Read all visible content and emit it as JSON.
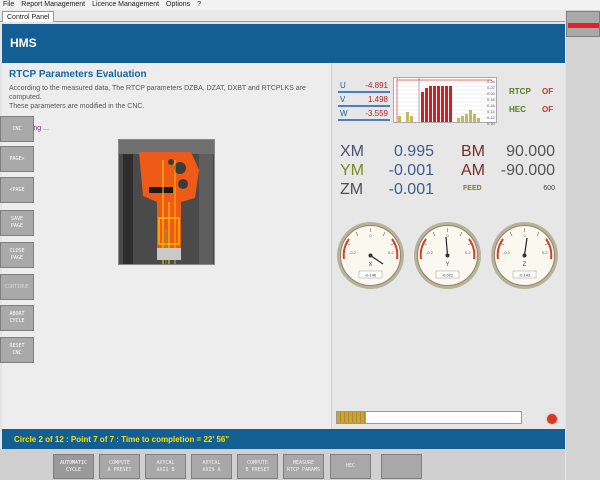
{
  "menu": [
    "File",
    "Report Management",
    "Licence Management",
    "Options",
    "?"
  ],
  "tab": "Control Panel",
  "header": {
    "title": "HMS"
  },
  "left": {
    "title": "RTCP Parameters Evaluation",
    "desc1": "According to the measured data, The RTCP parameters DZBA, DZAT, DXBT and RTCPLKS are computed.",
    "desc2": "These parameters are modified in the CNC.",
    "running": "> Running ..."
  },
  "readouts": {
    "u": {
      "label": "U",
      "value": "-4.891"
    },
    "v": {
      "label": "V",
      "value": "1.498"
    },
    "w": {
      "label": "W",
      "value": "-3.559"
    },
    "rtcp_label": "RTCP",
    "rtcp_state": "OF",
    "hec_label": "HEC",
    "hec_state": "OF"
  },
  "histogram_ticks": [
    "0.24",
    "0.22",
    "0.20",
    "0.18",
    "0.16",
    "0.14",
    "0.12",
    "0.10",
    "0.08",
    "0.06",
    "0.04",
    "0.02"
  ],
  "coords": {
    "xm": {
      "label": "XM",
      "value": "0.995"
    },
    "ym": {
      "label": "YM",
      "value": "-0.001"
    },
    "zm": {
      "label": "ZM",
      "value": "-0.001"
    },
    "bm": {
      "label": "BM",
      "value": "90.000"
    },
    "am": {
      "label": "AM",
      "value": "-90.000"
    },
    "feed": {
      "label": "FEED",
      "value": "600"
    }
  },
  "gauges": [
    {
      "axis": "X",
      "readout": "-0.146"
    },
    {
      "axis": "Y",
      "readout": "-0.022"
    },
    {
      "axis": "Z",
      "readout": "-0.143"
    }
  ],
  "side_buttons": [
    "CNC",
    "PAGE>",
    "<PAGE",
    "SAVE\nPAGE",
    "CLOSE\nPAGE",
    "CONTINUE",
    "ABORT\nCYCLE",
    "RESET\nCNC"
  ],
  "status": "Circle 2 of 12 : Point 7 of 7 : Time to completion =  22' 56\"",
  "bottom_buttons": [
    "AUTOMATIC\nCYCLE",
    "COMPUTE\nA PRESET",
    "AXYCAL\nAXIS B",
    "AXYCAL\nAXIS A",
    "COMPUTE\nB PRESET",
    "MEASURE\nRTCP PARAMS",
    "HEC",
    ""
  ],
  "progress": {
    "fraction": 0.16
  }
}
